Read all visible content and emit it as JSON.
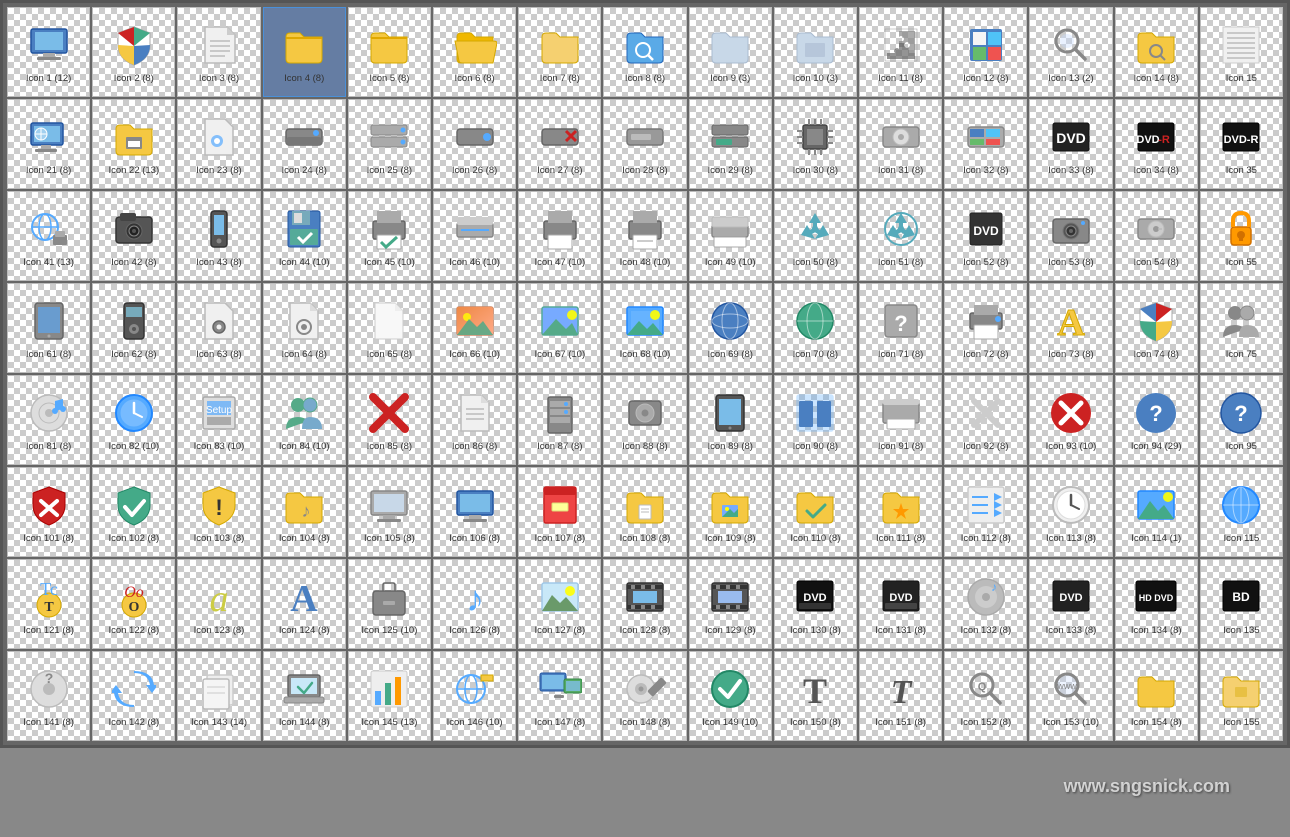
{
  "icons": [
    {
      "id": 1,
      "label": "Icon 1 (12)",
      "color": "#4a7fc1",
      "shape": "monitor",
      "selected": false
    },
    {
      "id": 2,
      "label": "Icon 2 (8)",
      "color": "#cc2222",
      "shape": "shield-color",
      "selected": false
    },
    {
      "id": 3,
      "label": "Icon 3 (8)",
      "color": "#eee",
      "shape": "document",
      "selected": false
    },
    {
      "id": 4,
      "label": "Icon 4 (8)",
      "color": "#f5c842",
      "shape": "folder",
      "selected": true
    },
    {
      "id": 5,
      "label": "Icon 5 (8)",
      "color": "#f5c842",
      "shape": "folder",
      "selected": false
    },
    {
      "id": 6,
      "label": "Icon 6 (8)",
      "color": "#f5c842",
      "shape": "folder-open",
      "selected": false
    },
    {
      "id": 7,
      "label": "Icon 7 (8)",
      "color": "#f5c842",
      "shape": "folder2",
      "selected": false
    },
    {
      "id": 8,
      "label": "Icon 8 (8)",
      "color": "#5aaae7",
      "shape": "folder-search",
      "selected": false
    },
    {
      "id": 9,
      "label": "Icon 9 (3)",
      "color": "#aabbd0",
      "shape": "folder-light",
      "selected": false
    },
    {
      "id": 10,
      "label": "Icon 10 (3)",
      "color": "#aabbd0",
      "shape": "folder-light2",
      "selected": false
    },
    {
      "id": 11,
      "label": "Icon 11 (8)",
      "color": "#888",
      "shape": "puzzle",
      "selected": false
    },
    {
      "id": 12,
      "label": "Icon 12 (8)",
      "color": "#4a7fc1",
      "shape": "win-square",
      "selected": false
    },
    {
      "id": 13,
      "label": "Icon 13 (2)",
      "color": "#888",
      "shape": "magnify",
      "selected": false
    },
    {
      "id": 14,
      "label": "Icon 14 (8)",
      "color": "#f5c842",
      "shape": "folder-search2",
      "selected": false
    },
    {
      "id": 15,
      "label": "Icon 15",
      "color": "#dde",
      "shape": "lines",
      "selected": false
    },
    {
      "id": 21,
      "label": "Icon 21 (8)",
      "color": "#4a7fc1",
      "shape": "globe-monitor",
      "selected": false
    },
    {
      "id": 22,
      "label": "Icon 22 (13)",
      "color": "#f5c842",
      "shape": "folder-printer",
      "selected": false
    },
    {
      "id": 23,
      "label": "Icon 23 (8)",
      "color": "#888",
      "shape": "settings-doc",
      "selected": false
    },
    {
      "id": 24,
      "label": "Icon 24 (8)",
      "color": "#888",
      "shape": "drive",
      "selected": false
    },
    {
      "id": 25,
      "label": "Icon 25 (8)",
      "color": "#aaa",
      "shape": "drive2",
      "selected": false
    },
    {
      "id": 26,
      "label": "Icon 26 (8)",
      "color": "#888",
      "shape": "drive3",
      "selected": false
    },
    {
      "id": 27,
      "label": "Icon 27 (8)",
      "color": "#888",
      "shape": "drive-x",
      "selected": false
    },
    {
      "id": 28,
      "label": "Icon 28 (8)",
      "color": "#888",
      "shape": "drive4",
      "selected": false
    },
    {
      "id": 29,
      "label": "Icon 29 (8)",
      "color": "#4a8",
      "shape": "drive-green",
      "selected": false
    },
    {
      "id": 30,
      "label": "Icon 30 (8)",
      "color": "#888",
      "shape": "chip",
      "selected": false
    },
    {
      "id": 31,
      "label": "Icon 31 (8)",
      "color": "#aaa",
      "shape": "drive5",
      "selected": false
    },
    {
      "id": 32,
      "label": "Icon 32 (8)",
      "color": "#4a7fc1",
      "shape": "win-drive",
      "selected": false
    },
    {
      "id": 33,
      "label": "Icon 33 (8)",
      "color": "#222",
      "shape": "dvd-label",
      "selected": false
    },
    {
      "id": 34,
      "label": "Icon 34 (8)",
      "color": "#222",
      "shape": "dvd-r",
      "selected": false
    },
    {
      "id": 35,
      "label": "Icon 35",
      "color": "#222",
      "shape": "dvd-r2",
      "selected": false
    },
    {
      "id": 41,
      "label": "Icon 41 (13)",
      "color": "#4a7fc1",
      "shape": "globe-print",
      "selected": false
    },
    {
      "id": 42,
      "label": "Icon 42 (8)",
      "color": "#888",
      "shape": "camera",
      "selected": false
    },
    {
      "id": 43,
      "label": "Icon 43 (8)",
      "color": "#555",
      "shape": "phone",
      "selected": false
    },
    {
      "id": 44,
      "label": "Icon 44 (10)",
      "color": "#4a7fc1",
      "shape": "floppy-check",
      "selected": false
    },
    {
      "id": 45,
      "label": "Icon 45 (10)",
      "color": "#888",
      "shape": "printer-ok",
      "selected": false
    },
    {
      "id": 46,
      "label": "Icon 46 (10)",
      "color": "#888",
      "shape": "scanner",
      "selected": false
    },
    {
      "id": 47,
      "label": "Icon 47 (10)",
      "color": "#888",
      "shape": "printer2",
      "selected": false
    },
    {
      "id": 48,
      "label": "Icon 48 (10)",
      "color": "#888",
      "shape": "printer3",
      "selected": false
    },
    {
      "id": 49,
      "label": "Icon 49 (10)",
      "color": "#888",
      "shape": "scanner2",
      "selected": false
    },
    {
      "id": 50,
      "label": "Icon 50 (8)",
      "color": "#5ab",
      "shape": "recycle",
      "selected": false
    },
    {
      "id": 51,
      "label": "Icon 51 (8)",
      "color": "#5ab",
      "shape": "recycle2",
      "selected": false
    },
    {
      "id": 52,
      "label": "Icon 52 (8)",
      "color": "#888",
      "shape": "dvd-disc",
      "selected": false
    },
    {
      "id": 53,
      "label": "Icon 53 (8)",
      "color": "#888",
      "shape": "camera2",
      "selected": false
    },
    {
      "id": 54,
      "label": "Icon 54 (8)",
      "color": "#aaa",
      "shape": "hdd",
      "selected": false
    },
    {
      "id": 55,
      "label": "Icon 55",
      "color": "#f90",
      "shape": "lock",
      "selected": false
    },
    {
      "id": 61,
      "label": "Icon 61 (8)",
      "color": "#888",
      "shape": "tablet",
      "selected": false
    },
    {
      "id": 62,
      "label": "Icon 62 (8)",
      "color": "#555",
      "shape": "mp3",
      "selected": false
    },
    {
      "id": 63,
      "label": "Icon 63 (8)",
      "color": "#eee",
      "shape": "doc-gear",
      "selected": false
    },
    {
      "id": 64,
      "label": "Icon 64 (8)",
      "color": "#888",
      "shape": "doc-gear2",
      "selected": false
    },
    {
      "id": 65,
      "label": "Icon 65 (8)",
      "color": "#aaa",
      "shape": "doc-blank",
      "selected": false
    },
    {
      "id": 66,
      "label": "Icon 66 (10)",
      "color": "#e84",
      "shape": "image",
      "selected": false
    },
    {
      "id": 67,
      "label": "Icon 67 (10)",
      "color": "#5a8",
      "shape": "landscape",
      "selected": false
    },
    {
      "id": 68,
      "label": "Icon 68 (10)",
      "color": "#5af",
      "shape": "photo",
      "selected": false
    },
    {
      "id": 69,
      "label": "Icon 69 (8)",
      "color": "#4a7fc1",
      "shape": "globe-3d",
      "selected": false
    },
    {
      "id": 70,
      "label": "Icon 70 (8)",
      "color": "#5a8",
      "shape": "globe-green",
      "selected": false
    },
    {
      "id": 71,
      "label": "Icon 71 (8)",
      "color": "#888",
      "shape": "question-box",
      "selected": false
    },
    {
      "id": 72,
      "label": "Icon 72 (8)",
      "color": "#888",
      "shape": "printer4",
      "selected": false
    },
    {
      "id": 73,
      "label": "Icon 73 (8)",
      "color": "#f5c842",
      "shape": "font-a",
      "selected": false
    },
    {
      "id": 74,
      "label": "Icon 74 (8)",
      "color": "#4a7fc1",
      "shape": "shield-win",
      "selected": false
    },
    {
      "id": 75,
      "label": "Icon 75",
      "color": "#888",
      "shape": "users",
      "selected": false
    },
    {
      "id": 81,
      "label": "Icon 81 (8)",
      "color": "#5af",
      "shape": "cd-music",
      "selected": false
    },
    {
      "id": 82,
      "label": "Icon 82 (10)",
      "color": "#5af",
      "shape": "clock",
      "selected": false
    },
    {
      "id": 83,
      "label": "Icon 83 (10)",
      "color": "#888",
      "shape": "installer",
      "selected": false
    },
    {
      "id": 84,
      "label": "Icon 84 (10)",
      "color": "#5a8",
      "shape": "users2",
      "selected": false
    },
    {
      "id": 85,
      "label": "Icon 85 (8)",
      "color": "#cc2222",
      "shape": "x-mark",
      "selected": false
    },
    {
      "id": 86,
      "label": "Icon 86 (8)",
      "color": "#eee",
      "shape": "document2",
      "selected": false
    },
    {
      "id": 87,
      "label": "Icon 87 (8)",
      "color": "#888",
      "shape": "server",
      "selected": false
    },
    {
      "id": 88,
      "label": "Icon 88 (8)",
      "color": "#888",
      "shape": "hdd2",
      "selected": false
    },
    {
      "id": 89,
      "label": "Icon 89 (8)",
      "color": "#555",
      "shape": "tablet2",
      "selected": false
    },
    {
      "id": 90,
      "label": "Icon 90 (8)",
      "color": "#4a7fc1",
      "shape": "columns",
      "selected": false
    },
    {
      "id": 91,
      "label": "Icon 91 (8)",
      "color": "#888",
      "shape": "scanner3",
      "selected": false
    },
    {
      "id": 92,
      "label": "Icon 92 (8)",
      "color": "#888",
      "shape": "x-light",
      "selected": false
    },
    {
      "id": 93,
      "label": "Icon 93 (10)",
      "color": "#cc2222",
      "shape": "x-circle",
      "selected": false
    },
    {
      "id": 94,
      "label": "Icon 94 (29)",
      "color": "#4a7fc1",
      "shape": "question-circle",
      "selected": false
    },
    {
      "id": 95,
      "label": "Icon 95",
      "color": "#4a7fc1",
      "shape": "question-circle2",
      "selected": false
    },
    {
      "id": 101,
      "label": "Icon 101 (8)",
      "color": "#cc2222",
      "shape": "x-shield",
      "selected": false
    },
    {
      "id": 102,
      "label": "Icon 102 (8)",
      "color": "#4a8",
      "shape": "check-shield",
      "selected": false
    },
    {
      "id": 103,
      "label": "Icon 103 (8)",
      "color": "#f5c842",
      "shape": "warn-shield",
      "selected": false
    },
    {
      "id": 104,
      "label": "Icon 104 (8)",
      "color": "#f5c842",
      "shape": "folder-music",
      "selected": false
    },
    {
      "id": 105,
      "label": "Icon 105 (8)",
      "color": "#5af",
      "shape": "monitor2",
      "selected": false
    },
    {
      "id": 106,
      "label": "Icon 106 (8)",
      "color": "#4a7fc1",
      "shape": "monitor3",
      "selected": false
    },
    {
      "id": 107,
      "label": "Icon 107 (8)",
      "color": "#e44",
      "shape": "archive",
      "selected": false
    },
    {
      "id": 108,
      "label": "Icon 108 (8)",
      "color": "#f5c842",
      "shape": "folder-doc",
      "selected": false
    },
    {
      "id": 109,
      "label": "Icon 109 (8)",
      "color": "#f5c842",
      "shape": "folder-pic",
      "selected": false
    },
    {
      "id": 110,
      "label": "Icon 110 (8)",
      "color": "#f5c842",
      "shape": "folder-check",
      "selected": false
    },
    {
      "id": 111,
      "label": "Icon 111 (8)",
      "color": "#f5c842",
      "shape": "folder-star",
      "selected": false
    },
    {
      "id": 112,
      "label": "Icon 112 (8)",
      "color": "#888",
      "shape": "list-arrows",
      "selected": false
    },
    {
      "id": 113,
      "label": "Icon 113 (8)",
      "color": "#888",
      "shape": "clock2",
      "selected": false
    },
    {
      "id": 114,
      "label": "Icon 114 (1)",
      "color": "#5af",
      "shape": "landscape2",
      "selected": false
    },
    {
      "id": 115,
      "label": "Icon 115",
      "color": "#4a7fc1",
      "shape": "globe2",
      "selected": false
    },
    {
      "id": 121,
      "label": "Icon 121 (8)",
      "color": "#f5c842",
      "shape": "font-badge",
      "selected": false
    },
    {
      "id": 122,
      "label": "Icon 122 (8)",
      "color": "#f5c842",
      "shape": "o-badge",
      "selected": false
    },
    {
      "id": 123,
      "label": "Icon 123 (8)",
      "color": "#cc4",
      "shape": "a-italic",
      "selected": false
    },
    {
      "id": 124,
      "label": "Icon 124 (8)",
      "color": "#4a7fc1",
      "shape": "font-a2",
      "selected": false
    },
    {
      "id": 125,
      "label": "Icon 125 (10)",
      "color": "#888",
      "shape": "briefcase",
      "selected": false
    },
    {
      "id": 126,
      "label": "Icon 126 (8)",
      "color": "#5af",
      "shape": "music-note",
      "selected": false
    },
    {
      "id": 127,
      "label": "Icon 127 (8)",
      "color": "#5af",
      "shape": "landscape3",
      "selected": false
    },
    {
      "id": 128,
      "label": "Icon 128 (8)",
      "color": "#888",
      "shape": "film",
      "selected": false
    },
    {
      "id": 129,
      "label": "Icon 129 (8)",
      "color": "#888",
      "shape": "film2",
      "selected": false
    },
    {
      "id": 130,
      "label": "Icon 130 (8)",
      "color": "#222",
      "shape": "dvd-disc2",
      "selected": false
    },
    {
      "id": 131,
      "label": "Icon 131 (8)",
      "color": "#222",
      "shape": "dvd-disc3",
      "selected": false
    },
    {
      "id": 132,
      "label": "Icon 132 (8)",
      "color": "#888",
      "shape": "disc-music",
      "selected": false
    },
    {
      "id": 133,
      "label": "Icon 133 (8)",
      "color": "#222",
      "shape": "dvd-label2",
      "selected": false
    },
    {
      "id": 134,
      "label": "Icon 134 (8)",
      "color": "#222",
      "shape": "hddvd",
      "selected": false
    },
    {
      "id": 135,
      "label": "Icon 135",
      "color": "#222",
      "shape": "bd",
      "selected": false
    },
    {
      "id": 141,
      "label": "Icon 141 (8)",
      "color": "#888",
      "shape": "cd-question",
      "selected": false
    },
    {
      "id": 142,
      "label": "Icon 142 (8)",
      "color": "#5af",
      "shape": "sync",
      "selected": false
    },
    {
      "id": 143,
      "label": "Icon 143 (14)",
      "color": "#888",
      "shape": "docs",
      "selected": false
    },
    {
      "id": 144,
      "label": "Icon 144 (8)",
      "color": "#888",
      "shape": "laptop-check",
      "selected": false
    },
    {
      "id": 145,
      "label": "Icon 145 (13)",
      "color": "#4a8",
      "shape": "chart",
      "selected": false
    },
    {
      "id": 146,
      "label": "Icon 146 (10)",
      "color": "#5af",
      "shape": "globe-doc",
      "selected": false
    },
    {
      "id": 147,
      "label": "Icon 147 (8)",
      "color": "#4a7fc1",
      "shape": "monitors",
      "selected": false
    },
    {
      "id": 148,
      "label": "Icon 148 (8)",
      "color": "#888",
      "shape": "cd-pen",
      "selected": false
    },
    {
      "id": 149,
      "label": "Icon 149 (10)",
      "color": "#4a8",
      "shape": "check-green",
      "selected": false
    },
    {
      "id": 150,
      "label": "Icon 150 (8)",
      "color": "#555",
      "shape": "font-t",
      "selected": false
    },
    {
      "id": 151,
      "label": "Icon 151 (8)",
      "color": "#555",
      "shape": "font-t2",
      "selected": false
    },
    {
      "id": 152,
      "label": "Icon 152 (8)",
      "color": "#888",
      "shape": "search-q",
      "selected": false
    },
    {
      "id": 153,
      "label": "Icon 153 (10)",
      "color": "#888",
      "shape": "search-q2",
      "selected": false
    },
    {
      "id": 154,
      "label": "Icon 154 (8)",
      "color": "#f5c842",
      "shape": "folder2b",
      "selected": false
    },
    {
      "id": 155,
      "label": "Icon 155",
      "color": "#f5c842",
      "shape": "folder3",
      "selected": false
    }
  ],
  "watermark": "www.sngsnick.com"
}
